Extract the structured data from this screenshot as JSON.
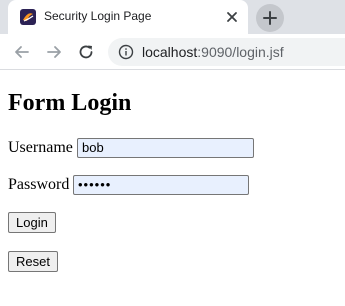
{
  "browser": {
    "tab": {
      "title": "Security Login Page",
      "favicon": "eclipse-favicon-icon",
      "close_icon": "close-icon"
    },
    "new_tab_icon": "plus-icon",
    "toolbar": {
      "back_icon": "back-arrow-icon",
      "forward_icon": "forward-arrow-icon",
      "reload_icon": "reload-icon",
      "info_icon": "info-icon",
      "url_host": "localhost",
      "url_path": ":9090/login.jsf"
    }
  },
  "page": {
    "title": "Form Login",
    "username": {
      "label": "Username",
      "value": "bob"
    },
    "password": {
      "label": "Password",
      "masked_value": "••••••"
    },
    "login_button": "Login",
    "reset_button": "Reset"
  },
  "colors": {
    "tabstrip": "#dee1e6",
    "omnibox": "#f1f3f4",
    "autofill_input": "#e8f0fe"
  }
}
